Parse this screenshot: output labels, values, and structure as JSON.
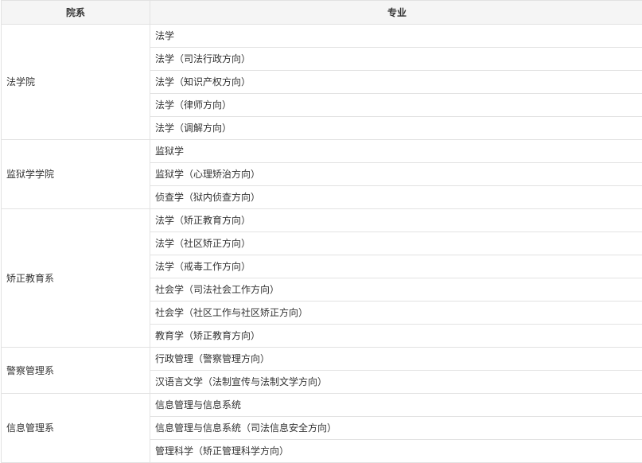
{
  "table": {
    "headers": [
      "院系",
      "专业"
    ],
    "groups": [
      {
        "department": "法学院",
        "majors": [
          "法学",
          "法学（司法行政方向）",
          "法学（知识产权方向）",
          "法学（律师方向）",
          "法学（调解方向）"
        ]
      },
      {
        "department": "监狱学学院",
        "majors": [
          "监狱学",
          "监狱学（心理矫治方向）",
          "侦查学（狱内侦查方向）"
        ]
      },
      {
        "department": "矫正教育系",
        "majors": [
          "法学（矫正教育方向）",
          "法学（社区矫正方向）",
          "法学（戒毒工作方向）",
          "社会学（司法社会工作方向）",
          "社会学（社区工作与社区矫正方向）",
          "教育学（矫正教育方向）"
        ]
      },
      {
        "department": "警察管理系",
        "majors": [
          "行政管理（警察管理方向）",
          "汉语言文学（法制宣传与法制文学方向）"
        ]
      },
      {
        "department": "信息管理系",
        "majors": [
          "信息管理与信息系统",
          "信息管理与信息系统（司法信息安全方向）",
          "管理科学（矫正管理科学方向）"
        ]
      }
    ]
  }
}
